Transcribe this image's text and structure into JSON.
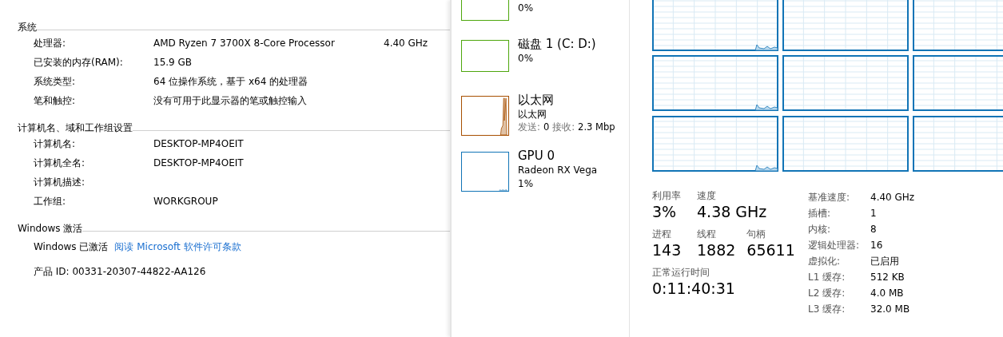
{
  "system_window": {
    "sections": [
      {
        "heading": "系统",
        "rows": [
          {
            "label": "处理器:",
            "value": "AMD Ryzen 7 3700X 8-Core Processor",
            "extra": "4.40 GHz"
          },
          {
            "label": "已安装的内存(RAM):",
            "value": "15.9 GB"
          },
          {
            "label": "系统类型:",
            "value": "64 位操作系统，基于 x64 的处理器"
          },
          {
            "label": "笔和触控:",
            "value": "没有可用于此显示器的笔或触控输入"
          }
        ]
      },
      {
        "heading": "计算机名、域和工作组设置",
        "rows": [
          {
            "label": "计算机名:",
            "value": "DESKTOP-MP4OEIT"
          },
          {
            "label": "计算机全名:",
            "value": "DESKTOP-MP4OEIT"
          },
          {
            "label": "计算机描述:"
          },
          {
            "label": "工作组:",
            "value": "WORKGROUP"
          }
        ]
      },
      {
        "heading": "Windows 激活",
        "activation": {
          "status": "Windows 已激活",
          "link": "阅读 Microsoft 软件许可条款"
        },
        "product_id": "产品 ID: 00331-20307-44822-AA126"
      }
    ]
  },
  "task_manager": {
    "sidebar": [
      {
        "kind": "disk",
        "subtitle": "0%",
        "color": "#4da60c"
      },
      {
        "kind": "disk",
        "title": "磁盘 1 (C: D:)",
        "subtitle": "0%",
        "color": "#4da60c"
      },
      {
        "kind": "network",
        "title": "以太网",
        "subtitle": "以太网",
        "send_label": "发送:",
        "send": "0",
        "recv_label": "接收:",
        "recv": "2.3 Mbp",
        "color": "#a74f01"
      },
      {
        "kind": "gpu",
        "title": "GPU 0",
        "subtitle": "Radeon RX Vega",
        "detail": "1%",
        "color": "#1174b6"
      }
    ],
    "stats": [
      [
        {
          "label": "利用率",
          "value": "3%"
        },
        {
          "label": "速度",
          "value": "4.38 GHz"
        }
      ],
      [
        {
          "label": "进程",
          "value": "143"
        },
        {
          "label": "线程",
          "value": "1882"
        },
        {
          "label": "句柄",
          "value": "65611"
        }
      ],
      [
        {
          "label": "正常运行时间",
          "value": "0:11:40:31"
        }
      ]
    ],
    "details": [
      {
        "label": "基准速度:",
        "value": "4.40 GHz"
      },
      {
        "label": "插槽:",
        "value": "1"
      },
      {
        "label": "内核:",
        "value": "8"
      },
      {
        "label": "逻辑处理器:",
        "value": "16"
      },
      {
        "label": "虚拟化:",
        "value": "已启用"
      },
      {
        "label": "L1 缓存:",
        "value": "512 KB"
      },
      {
        "label": "L2 缓存:",
        "value": "4.0 MB"
      },
      {
        "label": "L3 缓存:",
        "value": "32.0 MB"
      }
    ]
  }
}
